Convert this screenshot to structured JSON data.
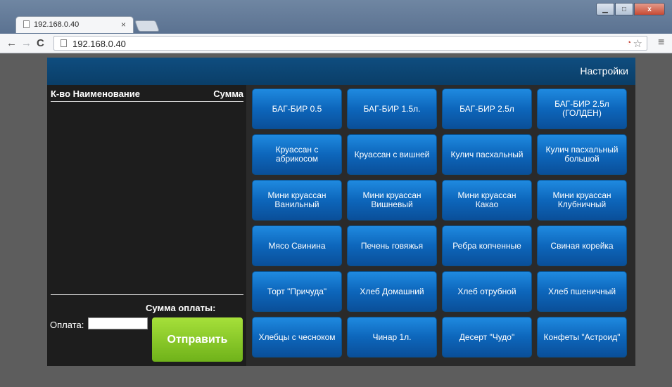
{
  "browser": {
    "tab_title": "192.168.0.40",
    "tab_close": "×",
    "url": "192.168.0.40",
    "win_min": "▁",
    "win_restore": "□",
    "win_close": "x"
  },
  "header": {
    "settings_label": "Настройки"
  },
  "order": {
    "col_name": "К-во Наименование",
    "col_sum": "Сумма",
    "total_label": "Сумма оплаты:",
    "pay_label": "Оплата:",
    "pay_value": "",
    "send_label": "Отправить"
  },
  "products": [
    "БАГ-БИР 0.5",
    "БАГ-БИР 1.5л.",
    "БАГ-БИР 2.5л",
    "БАГ-БИР 2.5л (ГОЛДЕН)",
    "Круассан с абрикосом",
    "Круассан с вишней",
    "Кулич пасхальный",
    "Кулич пасхальный большой",
    "Мини круассан Ванильный",
    "Мини круассан Вишневый",
    "Мини круассан Какао",
    "Мини круассан Клубничный",
    "Мясо Свинина",
    "Печень говяжья",
    "Ребра копченные",
    "Свиная корейка",
    "Торт \"Причуда\"",
    "Хлеб Домашний",
    "Хлеб отрубной",
    "Хлеб пшеничный",
    "Хлебцы с чесноком",
    "Чинар 1л.",
    "Десерт \"Чудо\"",
    "Конфеты \"Астроид\""
  ],
  "colors": {
    "header_blue": "#0f4d7f",
    "product_blue": "#0d66bb",
    "send_green": "#8cc928"
  }
}
